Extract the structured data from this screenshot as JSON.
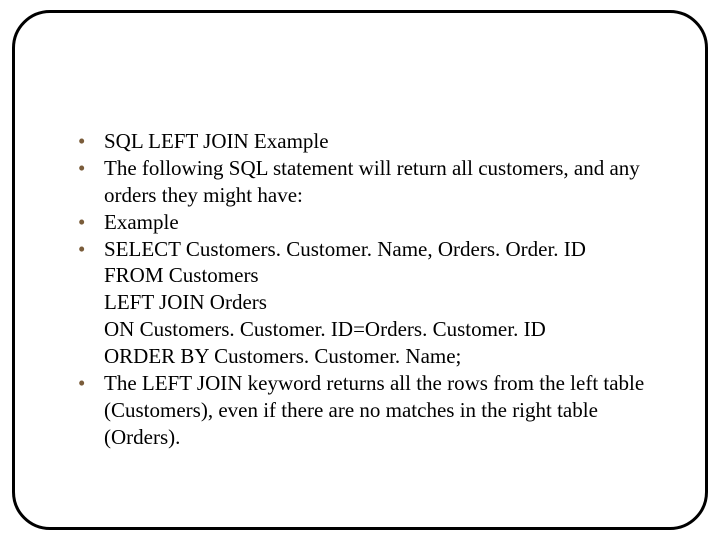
{
  "bullets": {
    "b1": "SQL LEFT JOIN Example",
    "b2": "The following SQL statement will return all customers, and any orders they might have:",
    "b3": "Example",
    "b4": {
      "l1": "SELECT Customers. Customer. Name, Orders. Order. ID",
      "l2": "FROM Customers",
      "l3": "LEFT JOIN Orders",
      "l4": "ON Customers. Customer. ID=Orders. Customer. ID",
      "l5": "ORDER BY Customers. Customer. Name;"
    },
    "b5": " The LEFT JOIN keyword returns all the rows from the left table (Customers), even if there are no matches in the right table (Orders)."
  }
}
